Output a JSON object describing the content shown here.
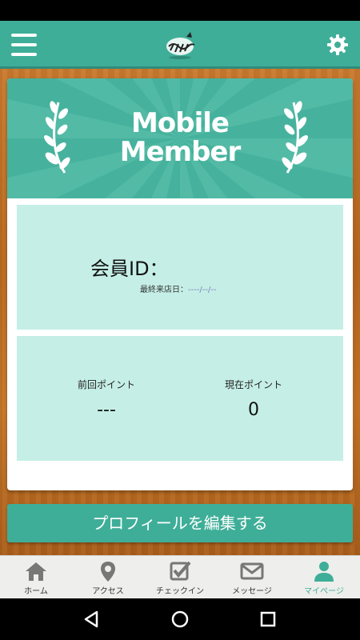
{
  "banner": {
    "title_line1": "Mobile",
    "title_line2": "Member"
  },
  "member": {
    "id_label": "会員ID：",
    "id_value": "",
    "last_visit_label": "最終来店日：",
    "last_visit_value": "----/--/--"
  },
  "points": {
    "previous_label": "前回ポイント",
    "previous_value": "---",
    "current_label": "現在ポイント",
    "current_value": "0"
  },
  "edit_profile_label": "プロフィールを編集する",
  "tabs": [
    {
      "label": "ホーム",
      "icon": "home-icon",
      "active": false
    },
    {
      "label": "アクセス",
      "icon": "map-pin-icon",
      "active": false
    },
    {
      "label": "チェックイン",
      "icon": "checkbox-icon",
      "active": false
    },
    {
      "label": "メッセージ",
      "icon": "envelope-icon",
      "active": false
    },
    {
      "label": "マイページ",
      "icon": "person-icon",
      "active": true
    }
  ],
  "colors": {
    "accent": "#3fae98",
    "panel": "#c5efe6",
    "inactive_tab": "#777777"
  },
  "icons": {
    "menu": "hamburger-menu-icon",
    "settings": "gear-icon",
    "logo": "zebra-logo-icon",
    "nav_back": "back-triangle-icon",
    "nav_home": "home-circle-icon",
    "nav_recents": "recents-square-icon"
  }
}
